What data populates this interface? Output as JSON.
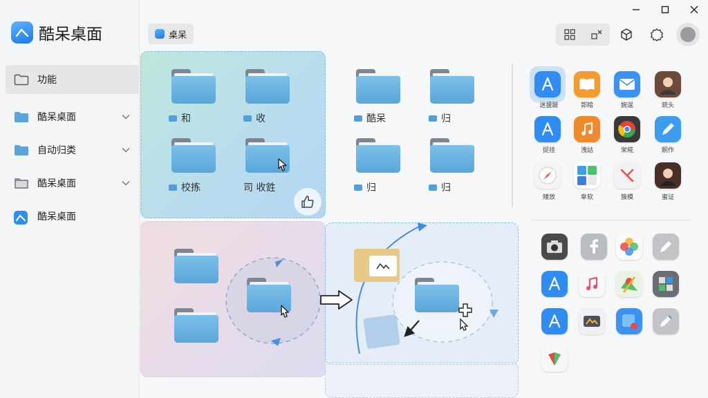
{
  "app": {
    "title": "酷呆桌面"
  },
  "sidebar": {
    "items": [
      {
        "label": "功能",
        "active": true
      },
      {
        "label": "酷呆桌面",
        "expandable": true
      },
      {
        "label": "自动归类",
        "expandable": true
      },
      {
        "label": "酷呆桌面",
        "expandable": true
      },
      {
        "label": "酷呆桌面",
        "expandable": false
      }
    ]
  },
  "toolbar": {
    "breadcrumb": "桌呆"
  },
  "folders": {
    "panel_a": [
      "和",
      "收",
      "校拣",
      "司 收鉎"
    ],
    "panel_right": [
      "酷呆",
      "归",
      "归",
      "归"
    ]
  },
  "apps": [
    {
      "label": "迷援跛",
      "icon": "app-store-icon",
      "color": "#2f8cf0"
    },
    {
      "label": "郭暗",
      "icon": "books-icon",
      "color": "#f39b2d"
    },
    {
      "label": "婉逞",
      "icon": "mail-icon",
      "color": "#3a93f0"
    },
    {
      "label": "銃头",
      "icon": "avatar-icon",
      "color": "#6b4a3a"
    },
    {
      "label": "捉挂",
      "icon": "app-store-icon",
      "color": "#2f8cf0"
    },
    {
      "label": "洩詁",
      "icon": "music-icon",
      "color": "#f08a2b"
    },
    {
      "label": "栄椛",
      "icon": "chrome-icon",
      "color": "#444"
    },
    {
      "label": "餇作",
      "icon": "pen-icon",
      "color": "#3c9cf0"
    },
    {
      "label": "矮敜",
      "icon": "safari-icon",
      "color": "#e7583b"
    },
    {
      "label": "傘软",
      "icon": "calculator-icon",
      "color": "#3aa0e8"
    },
    {
      "label": "簇模",
      "icon": "tools-icon",
      "color": "#e94a48"
    },
    {
      "label": "蜜证",
      "icon": "avatar-icon",
      "color": "#4a2f28"
    }
  ],
  "colors": {
    "accent": "#2f8cf0",
    "folder": "#5aa6da"
  }
}
